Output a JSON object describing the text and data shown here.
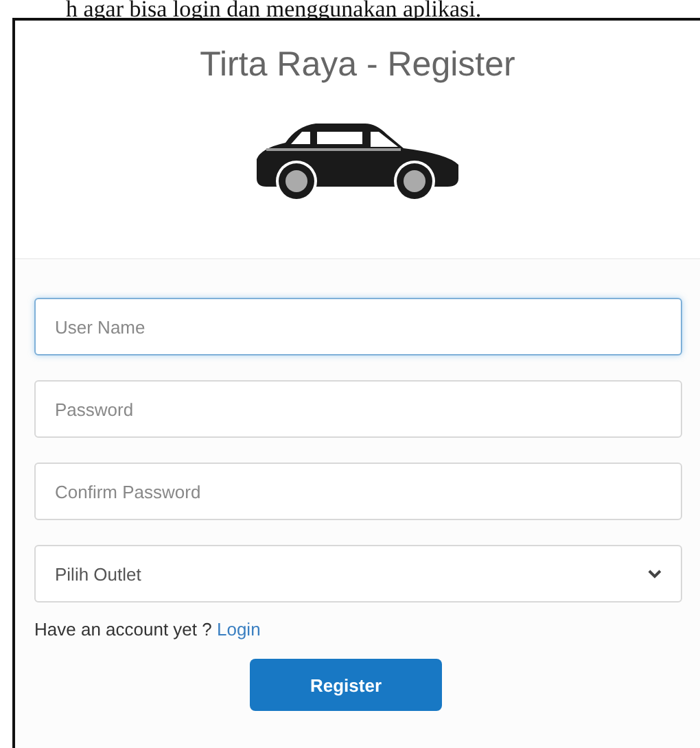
{
  "document_text": "h agar bisa login dan menggunakan aplikasi.",
  "form": {
    "title": "Tirta Raya - Register",
    "fields": [
      {
        "kind": "text",
        "placeholder": "User Name",
        "focused": true
      },
      {
        "kind": "password",
        "placeholder": "Password",
        "focused": false
      },
      {
        "kind": "password",
        "placeholder": "Confirm Password",
        "focused": false
      },
      {
        "kind": "select",
        "value": "Pilih Outlet",
        "focused": false
      }
    ],
    "account_prompt": "Have an account yet ?",
    "login_link": "Login",
    "submit_button": "Register"
  }
}
